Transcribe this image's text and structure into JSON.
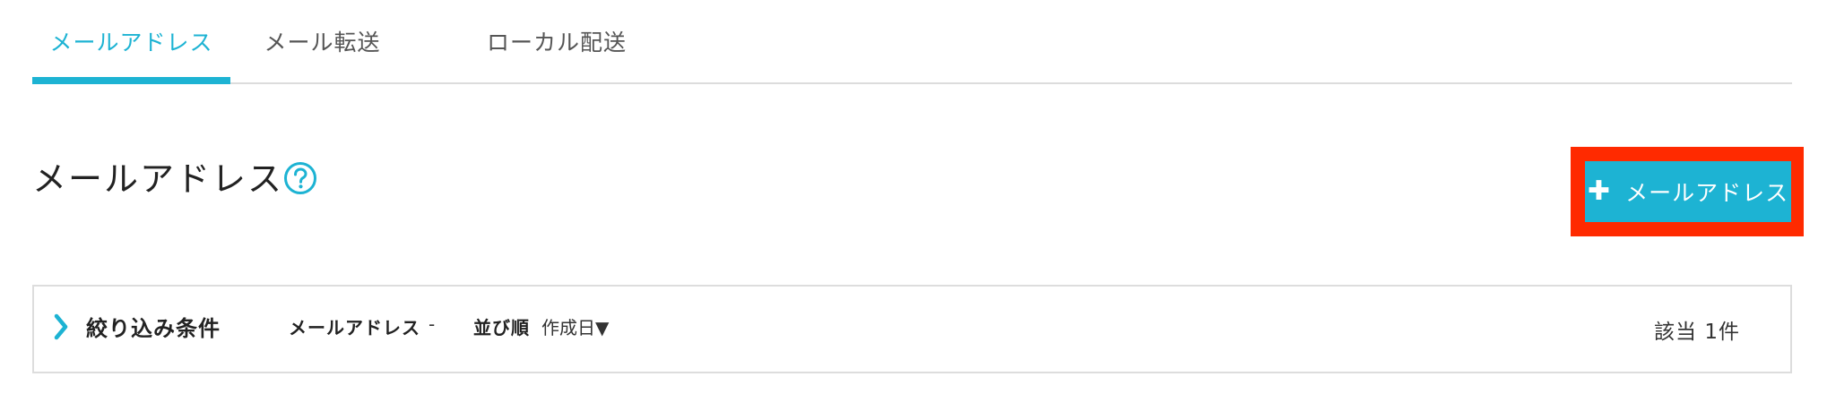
{
  "tabs": [
    {
      "label": "メールアドレス",
      "active": true
    },
    {
      "label": "メール転送",
      "active": false
    },
    {
      "label": "ローカル配送",
      "active": false
    }
  ],
  "page": {
    "title": "メールアドレス",
    "help_icon": "question-circle-icon"
  },
  "add_button": {
    "icon": "plus-icon",
    "label": "メールアドレス"
  },
  "filter": {
    "expand_icon": "chevron-right-icon",
    "title": "絞り込み条件",
    "email_label": "メールアドレス",
    "email_value": "-",
    "sort_label": "並び順",
    "sort_value": "作成日▼",
    "count": "該当 1件"
  },
  "colors": {
    "accent": "#1db3d3",
    "highlight": "#ff2a00",
    "border": "#dddddd"
  }
}
